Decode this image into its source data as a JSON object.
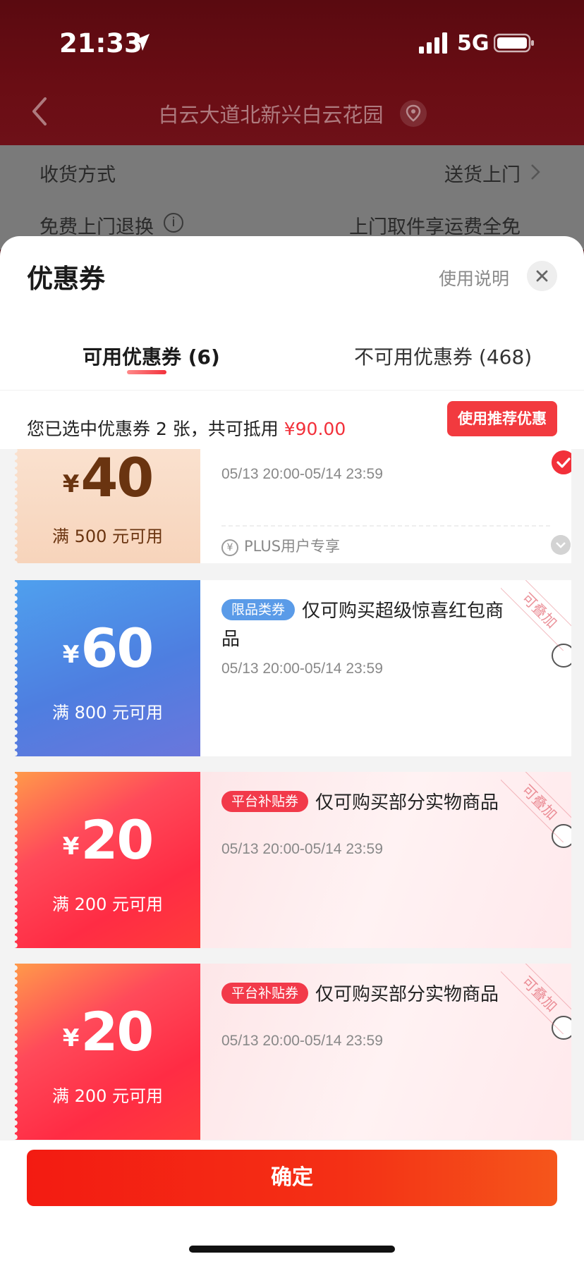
{
  "status_bar": {
    "time": "21:33",
    "network": "5G"
  },
  "background": {
    "address_title": "白云大道北新兴白云花园",
    "rows": [
      {
        "label": "收货方式",
        "value": "送货上门"
      },
      {
        "label": "免费上门退换",
        "value": "上门取件享运费全免"
      }
    ]
  },
  "sheet": {
    "title": "优惠券",
    "help_link": "使用说明",
    "tabs": [
      {
        "label": "可用优惠券 (6)",
        "active": true
      },
      {
        "label": "不可用优惠券 (468)",
        "active": false
      }
    ],
    "summary": {
      "text": "您已选中优惠券 2 张，共可抵用 ",
      "amount": "¥90.00"
    },
    "recommend_button": "使用推荐优惠"
  },
  "coupons": [
    {
      "yen": "¥",
      "amount": "40",
      "condition": "满 500 元可用",
      "tag": "",
      "description": "",
      "validity": "05/13 20:00-05/14 23:59",
      "note": "PLUS用户专享",
      "note_icon": "¥",
      "selected": true,
      "stackable": false
    },
    {
      "yen": "¥",
      "amount": "60",
      "condition": "满 800 元可用",
      "tag": "限品类券",
      "description": "仅可购买超级惊喜红包商品",
      "validity": "05/13 20:00-05/14 23:59",
      "selected": false,
      "stackable": true,
      "stack_label": "可叠加"
    },
    {
      "yen": "¥",
      "amount": "20",
      "condition": "满 200 元可用",
      "tag": "平台补贴券",
      "description": "仅可购买部分实物商品",
      "validity": "05/13 20:00-05/14 23:59",
      "selected": false,
      "stackable": true,
      "stack_label": "可叠加"
    },
    {
      "yen": "¥",
      "amount": "20",
      "condition": "满 200 元可用",
      "tag": "平台补贴券",
      "description": "仅可购买部分实物商品",
      "validity": "05/13 20:00-05/14 23:59",
      "selected": false,
      "stackable": true,
      "stack_label": "可叠加"
    }
  ],
  "footer": {
    "confirm_button": "确定"
  },
  "colors": {
    "accent_red": "#f2303a",
    "tag_blue": "#5a9be8",
    "tag_red": "#f23a4a",
    "coupon_blue": "#4e7ee0",
    "coupon_red": "#ff2c44",
    "coupon_peach": "#f7d4bb"
  }
}
